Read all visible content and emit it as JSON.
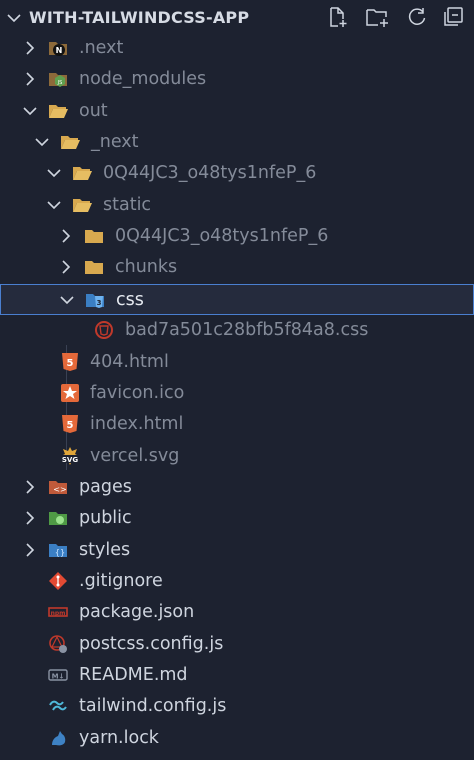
{
  "explorer": {
    "title": "WITH-TAILWINDCSS-APP",
    "actions": [
      {
        "name": "new-file-button",
        "icon": "new-file-icon"
      },
      {
        "name": "new-folder-button",
        "icon": "new-folder-icon"
      },
      {
        "name": "refresh-button",
        "icon": "refresh-icon"
      },
      {
        "name": "collapse-all-button",
        "icon": "collapse-all-icon"
      }
    ]
  },
  "tree": [
    {
      "label": ".next",
      "type": "folder",
      "depth": 0,
      "expanded": false,
      "icon": "next-folder-icon",
      "dim": true
    },
    {
      "label": "node_modules",
      "type": "folder",
      "depth": 0,
      "expanded": false,
      "icon": "node-folder-icon",
      "dim": true
    },
    {
      "label": "out",
      "type": "folder",
      "depth": 0,
      "expanded": true,
      "icon": "folder-open-icon",
      "dim": true
    },
    {
      "label": "_next",
      "type": "folder",
      "depth": 1,
      "expanded": true,
      "icon": "folder-open-icon",
      "dim": true
    },
    {
      "label": "0Q44JC3_o48tys1nfeP_6",
      "type": "folder",
      "depth": 2,
      "expanded": true,
      "icon": "folder-open-icon",
      "dim": true
    },
    {
      "label": "static",
      "type": "folder",
      "depth": 2,
      "expanded": true,
      "icon": "folder-open-icon",
      "dim": true
    },
    {
      "label": "0Q44JC3_o48tys1nfeP_6",
      "type": "folder",
      "depth": 3,
      "expanded": false,
      "icon": "folder-icon",
      "dim": true
    },
    {
      "label": "chunks",
      "type": "folder",
      "depth": 3,
      "expanded": false,
      "icon": "folder-icon",
      "dim": true
    },
    {
      "label": "css",
      "type": "folder",
      "depth": 3,
      "expanded": true,
      "icon": "css-folder-icon",
      "dim": false,
      "selected": true
    },
    {
      "label": "bad7a501c28bfb5f84a8.css",
      "type": "file",
      "depth": 4,
      "icon": "css-file-icon",
      "dim": true
    },
    {
      "label": "404.html",
      "type": "file",
      "depth": 2,
      "icon": "html-file-icon",
      "dim": true
    },
    {
      "label": "favicon.ico",
      "type": "file",
      "depth": 2,
      "icon": "favicon-file-icon",
      "dim": true
    },
    {
      "label": "index.html",
      "type": "file",
      "depth": 2,
      "icon": "html-file-icon",
      "dim": true
    },
    {
      "label": "vercel.svg",
      "type": "file",
      "depth": 2,
      "icon": "svg-file-icon",
      "dim": true
    },
    {
      "label": "pages",
      "type": "folder",
      "depth": 0,
      "expanded": false,
      "icon": "pages-folder-icon",
      "dim": false
    },
    {
      "label": "public",
      "type": "folder",
      "depth": 0,
      "expanded": false,
      "icon": "public-folder-icon",
      "dim": false
    },
    {
      "label": "styles",
      "type": "folder",
      "depth": 0,
      "expanded": false,
      "icon": "styles-folder-icon",
      "dim": false
    },
    {
      "label": ".gitignore",
      "type": "file",
      "depth": 0,
      "icon": "git-file-icon",
      "dim": false
    },
    {
      "label": "package.json",
      "type": "file",
      "depth": 0,
      "icon": "npm-file-icon",
      "dim": false
    },
    {
      "label": "postcss.config.js",
      "type": "file",
      "depth": 0,
      "icon": "postcss-file-icon",
      "dim": false
    },
    {
      "label": "README.md",
      "type": "file",
      "depth": 0,
      "icon": "markdown-file-icon",
      "dim": false
    },
    {
      "label": "tailwind.config.js",
      "type": "file",
      "depth": 0,
      "icon": "tailwind-file-icon",
      "dim": false
    },
    {
      "label": "yarn.lock",
      "type": "file",
      "depth": 0,
      "icon": "yarn-file-icon",
      "dim": false
    }
  ],
  "colors": {
    "background": "#1d2230",
    "text": "#cfd5df",
    "dimText": "#848b99",
    "selectedBg": "#252b3d",
    "selectedBorder": "#4a7fd0",
    "folder": "#d8a94f",
    "html": "#e4693a",
    "css": "#2f86d3"
  }
}
